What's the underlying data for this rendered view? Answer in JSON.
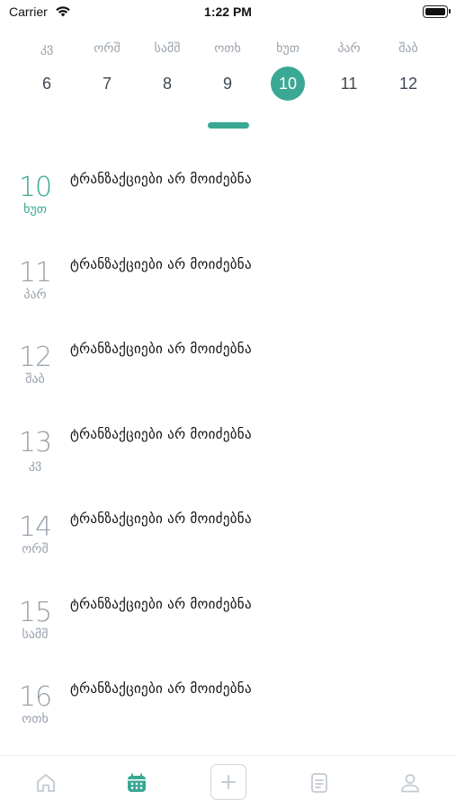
{
  "status_bar": {
    "carrier": "Carrier",
    "time": "1:22 PM"
  },
  "week": {
    "days": [
      {
        "name": "კვ",
        "num": "6",
        "selected": false
      },
      {
        "name": "ორშ",
        "num": "7",
        "selected": false
      },
      {
        "name": "სამშ",
        "num": "8",
        "selected": false
      },
      {
        "name": "ოთხ",
        "num": "9",
        "selected": false
      },
      {
        "name": "ხუთ",
        "num": "10",
        "selected": true
      },
      {
        "name": "პარ",
        "num": "11",
        "selected": false
      },
      {
        "name": "შაბ",
        "num": "12",
        "selected": false
      }
    ]
  },
  "list": {
    "rows": [
      {
        "num": "10",
        "dow": "ხუთ",
        "message": "ტრანზაქციები არ მოიძებნა",
        "active": true
      },
      {
        "num": "11",
        "dow": "პარ",
        "message": "ტრანზაქციები არ მოიძებნა",
        "active": false
      },
      {
        "num": "12",
        "dow": "შაბ",
        "message": "ტრანზაქციები არ მოიძებნა",
        "active": false
      },
      {
        "num": "13",
        "dow": "კვ",
        "message": "ტრანზაქციები არ მოიძებნა",
        "active": false
      },
      {
        "num": "14",
        "dow": "ორშ",
        "message": "ტრანზაქციები არ მოიძებნა",
        "active": false
      },
      {
        "num": "15",
        "dow": "სამშ",
        "message": "ტრანზაქციები არ მოიძებნა",
        "active": false
      },
      {
        "num": "16",
        "dow": "ოთხ",
        "message": "ტრანზაქციები არ მოიძებნა",
        "active": false
      }
    ]
  },
  "tab_bar": {
    "tabs": [
      {
        "icon": "home-icon",
        "active": false
      },
      {
        "icon": "calendar-icon",
        "active": true
      },
      {
        "icon": "plus-icon",
        "active": false
      },
      {
        "icon": "document-icon",
        "active": false
      },
      {
        "icon": "profile-icon",
        "active": false
      }
    ]
  },
  "colors": {
    "accent": "#3aa893",
    "muted_text": "#97a0ab",
    "inactive_icon": "#c3cad1"
  }
}
